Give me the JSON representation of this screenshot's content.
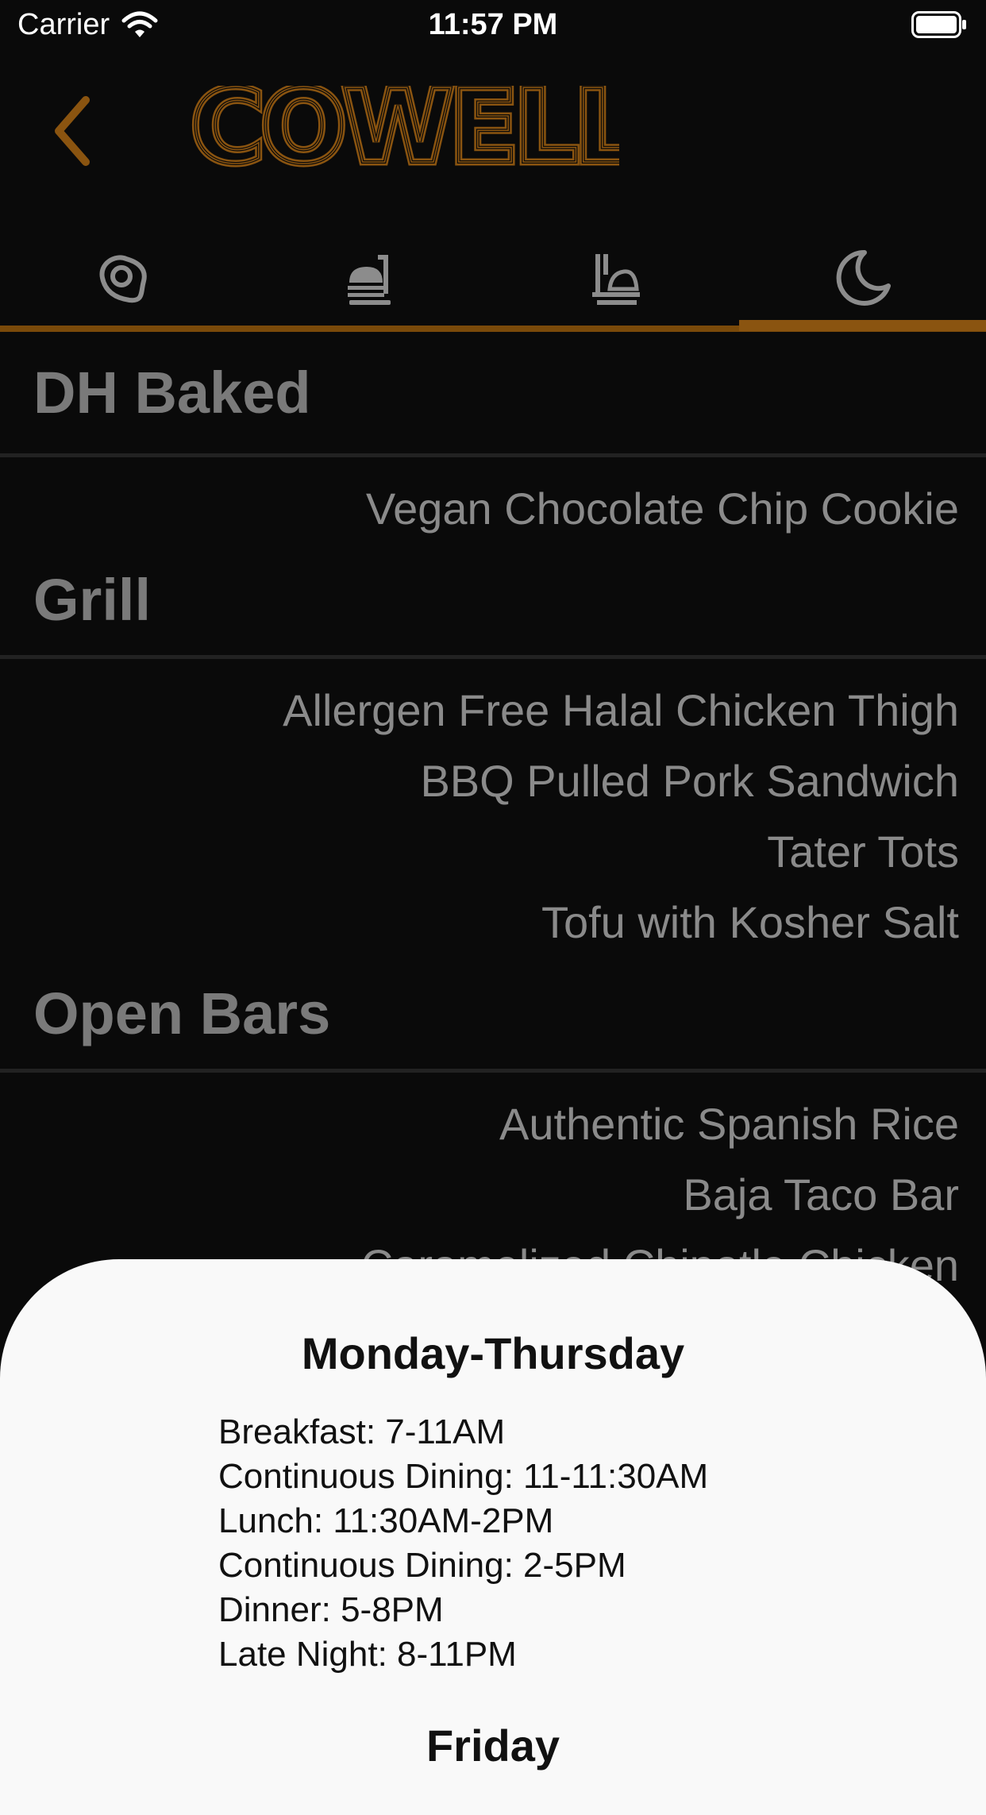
{
  "status_bar": {
    "carrier": "Carrier",
    "time": "11:57 PM"
  },
  "header": {
    "logo_text": "COWELL",
    "accent_color": "#8a5410"
  },
  "tabs": [
    {
      "icon": "breakfast-egg-icon"
    },
    {
      "icon": "lunch-tray-icon"
    },
    {
      "icon": "dinner-icon"
    },
    {
      "icon": "late-night-moon-icon",
      "selected": true
    }
  ],
  "menu": {
    "sections": [
      {
        "title": "DH Baked",
        "items": [
          "Vegan Chocolate Chip Cookie"
        ]
      },
      {
        "title": "Grill",
        "items": [
          "Allergen Free Halal Chicken Thigh",
          "BBQ Pulled Pork Sandwich",
          "Tater Tots",
          "Tofu with Kosher Salt"
        ]
      },
      {
        "title": "Open Bars",
        "items": [
          "Authentic Spanish Rice",
          "Baja Taco Bar",
          "Caramelized Chipotle Chicken"
        ]
      }
    ]
  },
  "hours_sheet": {
    "weekday_title": "Monday-Thursday",
    "weekday_hours": [
      "Breakfast: 7-11AM",
      "Continuous Dining: 11-11:30AM",
      "Lunch: 11:30AM-2PM",
      "Continuous Dining: 2-5PM",
      "Dinner: 5-8PM",
      "Late Night: 8-11PM"
    ],
    "friday_title": "Friday"
  }
}
